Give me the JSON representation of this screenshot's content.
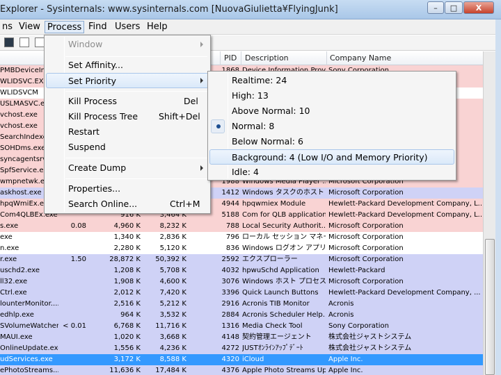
{
  "window": {
    "title": "Explorer - Sysinternals: www.sysinternals.com [NuovaGiulietta¥FlyingJunk]",
    "minimize": "–",
    "maximize": "□",
    "close": "X"
  },
  "menubar": {
    "items": [
      "ns",
      "View",
      "Process",
      "Find",
      "Users",
      "Help"
    ]
  },
  "columns": {
    "pid": "PID",
    "description": "Description",
    "company": "Company Name"
  },
  "rows": [
    {
      "name": "PMBDeviceInf...",
      "cpu": "",
      "pb": "",
      "ws": "",
      "pid": "1868",
      "desc": "Device Information Prov...",
      "comp": "Sony Corporation",
      "style": "pink"
    },
    {
      "name": "WLIDSVC.EXE",
      "cpu": "",
      "pb": "",
      "ws": "",
      "pid": "",
      "desc": "",
      "comp": "",
      "style": "pink"
    },
    {
      "name": "WLIDSVCM",
      "cpu": "",
      "pb": "",
      "ws": "",
      "pid": "",
      "desc": "",
      "comp": "",
      "style": "white"
    },
    {
      "name": "USLMASVC.exe",
      "cpu": "",
      "pb": "",
      "ws": "",
      "pid": "",
      "desc": "",
      "comp": "",
      "style": "pink"
    },
    {
      "name": "vchost.exe",
      "cpu": "",
      "pb": "",
      "ws": "",
      "pid": "",
      "desc": "",
      "comp": "",
      "style": "pink"
    },
    {
      "name": "vchost.exe",
      "cpu": "",
      "pb": "",
      "ws": "",
      "pid": "",
      "desc": "",
      "comp": "",
      "style": "pink"
    },
    {
      "name": "SearchIndexe",
      "cpu": "",
      "pb": "",
      "ws": "",
      "pid": "",
      "desc": "",
      "comp": "",
      "style": "pink"
    },
    {
      "name": "SOHDms.exe",
      "cpu": "",
      "pb": "",
      "ws": "",
      "pid": "",
      "desc": "",
      "comp": "",
      "style": "pink"
    },
    {
      "name": "syncagentsrv.",
      "cpu": "",
      "pb": "",
      "ws": "",
      "pid": "",
      "desc": "",
      "comp": "",
      "style": "pink"
    },
    {
      "name": "SpfService.exe",
      "cpu": "",
      "pb": "",
      "ws": "",
      "pid": "",
      "desc": "",
      "comp": "",
      "style": "pink"
    },
    {
      "name": "wmpnetwk.exe",
      "cpu": "",
      "pb": "",
      "ws": "",
      "pid": "1988",
      "desc": "Windows Media Player ...",
      "comp": "Microsoft Corporation",
      "style": "pink"
    },
    {
      "name": "askhost.exe",
      "cpu": "",
      "pb": "",
      "ws": "",
      "pid": "1412",
      "desc": "Windows タスクのホスト プ...",
      "comp": "Microsoft Corporation",
      "style": "lav"
    },
    {
      "name": "hpqWmiEx.exe",
      "cpu": "",
      "pb": "",
      "ws": "",
      "pid": "4944",
      "desc": "hpqwmiex Module",
      "comp": "Hewlett-Packard Development Company, L...",
      "style": "pink"
    },
    {
      "name": "Com4QLBEx.exe",
      "cpu": "",
      "pb": "916 K",
      "ws": "3,464 K",
      "pid": "5188",
      "desc": "Com for QLB application",
      "comp": "Hewlett-Packard Development Company, L...",
      "style": "pink"
    },
    {
      "name": "s.exe",
      "cpu": "0.08",
      "pb": "4,960 K",
      "ws": "8,232 K",
      "pid": "788",
      "desc": "Local Security Authorit...",
      "comp": "Microsoft Corporation",
      "style": "pink"
    },
    {
      "name": "exe",
      "cpu": "",
      "pb": "1,340 K",
      "ws": "2,836 K",
      "pid": "796",
      "desc": "ローカル セッション マネージ...",
      "comp": "Microsoft Corporation",
      "style": "white"
    },
    {
      "name": "n.exe",
      "cpu": "",
      "pb": "2,280 K",
      "ws": "5,120 K",
      "pid": "836",
      "desc": "Windows ログオン アプリケ...",
      "comp": "Microsoft Corporation",
      "style": "white"
    },
    {
      "name": "r.exe",
      "cpu": "1.50",
      "pb": "28,872 K",
      "ws": "50,392 K",
      "pid": "2592",
      "desc": "エクスプローラー",
      "comp": "Microsoft Corporation",
      "style": "lav"
    },
    {
      "name": "uschd2.exe",
      "cpu": "",
      "pb": "1,208 K",
      "ws": "5,708 K",
      "pid": "4032",
      "desc": "hpwuSchd Application",
      "comp": "Hewlett-Packard",
      "style": "lav"
    },
    {
      "name": "ll32.exe",
      "cpu": "",
      "pb": "1,908 K",
      "ws": "4,600 K",
      "pid": "3076",
      "desc": "Windows ホスト プロセス (...",
      "comp": "Microsoft Corporation",
      "style": "lav"
    },
    {
      "name": "Ctrl.exe",
      "cpu": "",
      "pb": "2,012 K",
      "ws": "7,420 K",
      "pid": "3396",
      "desc": "Quick Launch Buttons",
      "comp": "Hewlett-Packard Development Company, ...",
      "style": "lav"
    },
    {
      "name": "lounterMonitor....",
      "cpu": "",
      "pb": "2,516 K",
      "ws": "5,212 K",
      "pid": "2916",
      "desc": "Acronis TIB Monitor",
      "comp": "Acronis",
      "style": "lav"
    },
    {
      "name": "edhlp.exe",
      "cpu": "",
      "pb": "964 K",
      "ws": "3,532 K",
      "pid": "2884",
      "desc": "Acronis Scheduler Help...",
      "comp": "Acronis",
      "style": "lav"
    },
    {
      "name": "SVolumeWatcher....",
      "cpu": "< 0.01",
      "pb": "6,768 K",
      "ws": "11,716 K",
      "pid": "1316",
      "desc": "Media Check Tool",
      "comp": "Sony Corporation",
      "style": "lav"
    },
    {
      "name": "MAUI.exe",
      "cpu": "",
      "pb": "1,020 K",
      "ws": "3,668 K",
      "pid": "4148",
      "desc": "契約管理エージェント",
      "comp": "株式会社ジャストシステム",
      "style": "lav"
    },
    {
      "name": "OnlineUpdate.exe",
      "cpu": "",
      "pb": "1,556 K",
      "ws": "4,236 K",
      "pid": "4272",
      "desc": "JUSTｵﾝﾗｲﾝｱｯﾌﾟﾃﾞｰﾄ",
      "comp": "株式会社ジャストシステム",
      "style": "lav"
    },
    {
      "name": "udServices.exe",
      "cpu": "",
      "pb": "3,172 K",
      "ws": "8,588 K",
      "pid": "4320",
      "desc": "iCloud",
      "comp": "Apple Inc.",
      "style": "sel"
    },
    {
      "name": "ePhotoStreams....",
      "cpu": "",
      "pb": "11,636 K",
      "ws": "17,484 K",
      "pid": "4376",
      "desc": "Apple Photo Streams Upl...",
      "comp": "Apple Inc.",
      "style": "lav"
    }
  ],
  "process_menu": {
    "window": "Window",
    "set_affinity": "Set Affinity...",
    "set_priority": "Set Priority",
    "kill_process": "Kill Process",
    "kill_process_shortcut": "Del",
    "kill_process_tree": "Kill Process Tree",
    "kill_process_tree_shortcut": "Shift+Del",
    "restart": "Restart",
    "suspend": "Suspend",
    "create_dump": "Create Dump",
    "properties": "Properties...",
    "search_online": "Search Online...",
    "search_online_shortcut": "Ctrl+M"
  },
  "priority_menu": {
    "realtime": "Realtime: 24",
    "high": "High: 13",
    "above_normal": "Above Normal: 10",
    "normal": "Normal: 8",
    "below_normal": "Below Normal: 6",
    "background": "Background: 4 (Low I/O and Memory Priority)",
    "idle": "Idle: 4",
    "checked": "normal"
  }
}
